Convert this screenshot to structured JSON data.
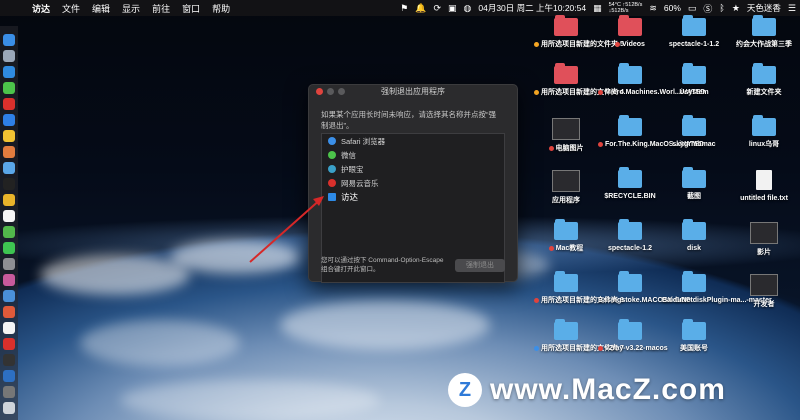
{
  "menubar": {
    "app_name": "访达",
    "items": [
      "文件",
      "编辑",
      "显示",
      "前往",
      "窗口",
      "帮助"
    ],
    "cpu_temp": "54°C",
    "net_up": "↑512B/s",
    "net_down": "↓512B/s",
    "battery": "60%",
    "datetime": "04月30日 周二 上午10:20:54",
    "user": "天色迷香"
  },
  "force_quit": {
    "title": "强制退出应用程序",
    "description": "如果某个应用长时间未响应，请选择其名称并点按“强制退出”。",
    "apps": [
      {
        "name": "Safari 浏览器",
        "color": "#3b8fe8",
        "icon": "safari-icon"
      },
      {
        "name": "微信",
        "color": "#4cc34a",
        "icon": "wechat-icon"
      },
      {
        "name": "护眼宝",
        "color": "#3aa0c8",
        "icon": "eye-care-icon"
      },
      {
        "name": "网易云音乐",
        "color": "#d9302c",
        "icon": "netease-music-icon"
      },
      {
        "name": "访达",
        "color": "#2d8ae6",
        "icon": "finder-icon"
      }
    ],
    "selected_index": 4,
    "hint": "您可以通过按下 Command-Option-Escape 组合键打开此窗口。",
    "button_label": "强制退出"
  },
  "desktop_icons": [
    {
      "label": "用所选项目新建的文件夹 5",
      "kind": "folder-red",
      "tag": "#f5a623"
    },
    {
      "label": "Videos",
      "kind": "folder-red",
      "tag": "#e0443e"
    },
    {
      "label": "spectacle-1-1.2",
      "kind": "folder",
      "tag": ""
    },
    {
      "label": "约会大作战第三季",
      "kind": "folder",
      "tag": ""
    },
    {
      "label": "用所选项目新建的文件夹 4",
      "kind": "folder-red",
      "tag": "#f5a623"
    },
    {
      "label": "Micro.Machines.Worl...iVATED",
      "kind": "folder",
      "tag": "#e0443e"
    },
    {
      "label": "Usystem",
      "kind": "folder",
      "tag": ""
    },
    {
      "label": "新建文件夹",
      "kind": "folder",
      "tag": ""
    },
    {
      "label": "电脑图片",
      "kind": "thumb",
      "tag": "#e0443e"
    },
    {
      "label": "For.The.King.MacOS...iVATED",
      "kind": "folder",
      "tag": "#e0443e"
    },
    {
      "label": "skygrmbmac",
      "kind": "folder",
      "tag": ""
    },
    {
      "label": "linux乌哥",
      "kind": "folder",
      "tag": ""
    },
    {
      "label": "应用程序",
      "kind": "thumb",
      "tag": ""
    },
    {
      "label": "$RECYCLE.BIN",
      "kind": "folder",
      "tag": ""
    },
    {
      "label": "截图",
      "kind": "folder",
      "tag": ""
    },
    {
      "label": "untitled file.txt",
      "kind": "file",
      "tag": ""
    },
    {
      "label": "Mac教程",
      "kind": "folder",
      "tag": "#e0443e"
    },
    {
      "label": "spectacle-1.2",
      "kind": "folder",
      "tag": ""
    },
    {
      "label": "disk",
      "kind": "folder",
      "tag": ""
    },
    {
      "label": "影片",
      "kind": "thumb",
      "tag": ""
    },
    {
      "label": "用所选项目新建的文件夹 9",
      "kind": "folder",
      "tag": "#e0443e"
    },
    {
      "label": "Basingstoke.MACOSX-GOG",
      "kind": "folder",
      "tag": ""
    },
    {
      "label": "BaiduNetdiskPlugin-ma...-master",
      "kind": "folder",
      "tag": ""
    },
    {
      "label": "开发者",
      "kind": "thumb",
      "tag": ""
    },
    {
      "label": "用所选项目新建的文件夹 7",
      "kind": "folder",
      "tag": "#3b8fe8"
    },
    {
      "label": "v2ray-v3.22-macos",
      "kind": "folder",
      "tag": "#e0443e"
    },
    {
      "label": "美国账号",
      "kind": "folder",
      "tag": ""
    }
  ],
  "watermark": {
    "logo_letter": "Z",
    "text": "www.MacZ.com"
  },
  "colors": {
    "menubar_bg": "#141416",
    "window_bg": "#2b2b2d",
    "accent": "#3b8fe8",
    "arrow": "#d62828"
  }
}
